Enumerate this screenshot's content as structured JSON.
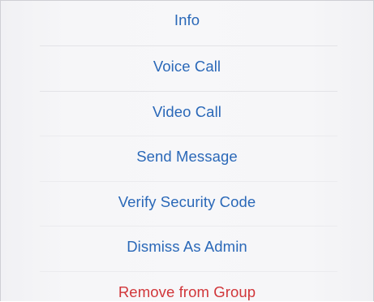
{
  "action_sheet": {
    "items": [
      {
        "label": "Info",
        "color": "#2a68b8"
      },
      {
        "label": "Voice Call",
        "color": "#2a68b8"
      },
      {
        "label": "Video Call",
        "color": "#2a68b8"
      },
      {
        "label": "Send Message",
        "color": "#2a68b8"
      },
      {
        "label": "Verify Security Code",
        "color": "#2a68b8"
      },
      {
        "label": "Dismiss As Admin",
        "color": "#2a68b8"
      },
      {
        "label": "Remove from Group",
        "color": "#d1363a"
      }
    ]
  }
}
